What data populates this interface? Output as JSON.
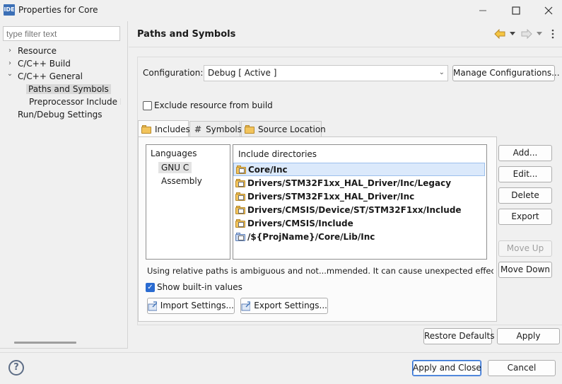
{
  "window": {
    "app_icon_text": "IDE",
    "title": "Properties for Core"
  },
  "sidebar": {
    "filter_placeholder": "type filter text",
    "items": [
      {
        "label": "Resource",
        "arrow": "›"
      },
      {
        "label": "C/C++ Build",
        "arrow": "›"
      },
      {
        "label": "C/C++ General",
        "arrow": "⌄"
      },
      {
        "label": "Paths and Symbols"
      },
      {
        "label": "Preprocessor Include Pa"
      },
      {
        "label": "Run/Debug Settings"
      }
    ]
  },
  "header": {
    "title": "Paths and Symbols"
  },
  "config": {
    "label": "Configuration:",
    "value": "Debug  [ Active ]",
    "manage_label": "Manage Configurations..."
  },
  "exclude": {
    "label": "Exclude resource from build",
    "checked": false
  },
  "tabs": [
    {
      "label": "Includes",
      "icon": "folder-icon",
      "active": true
    },
    {
      "label": "Symbols",
      "icon": "hash-icon"
    },
    {
      "label": "Source Location",
      "icon": "folder-icon"
    }
  ],
  "languages": {
    "header": "Languages",
    "items": [
      "GNU C",
      "Assembly"
    ]
  },
  "include_dirs": {
    "header": "Include directories",
    "rows": [
      "Core/Inc",
      "Drivers/STM32F1xx_HAL_Driver/Inc/Legacy",
      "Drivers/STM32F1xx_HAL_Driver/Inc",
      "Drivers/CMSIS/Device/ST/STM32F1xx/Include",
      "Drivers/CMSIS/Include",
      "/${ProjName}/Core/Lib/Inc"
    ]
  },
  "side_buttons": {
    "add": "Add...",
    "edit": "Edit...",
    "delete": "Delete",
    "export": "Export",
    "move_up": "Move Up",
    "move_down": "Move Down"
  },
  "warning_text": "Using relative paths is ambiguous and not...mmended. It can cause unexpected effects.",
  "show_builtin": {
    "label": "Show built-in values",
    "checked": true
  },
  "import_label": "Import Settings...",
  "export_settings_label": "Export Settings...",
  "footer": {
    "restore_defaults": "Restore Defaults",
    "apply": "Apply",
    "apply_close": "Apply and Close",
    "cancel": "Cancel",
    "help_glyph": "?"
  },
  "colors": {
    "accent": "#2a6bd1",
    "selection": "#dbe9fb",
    "folder": "#f2c45c"
  }
}
